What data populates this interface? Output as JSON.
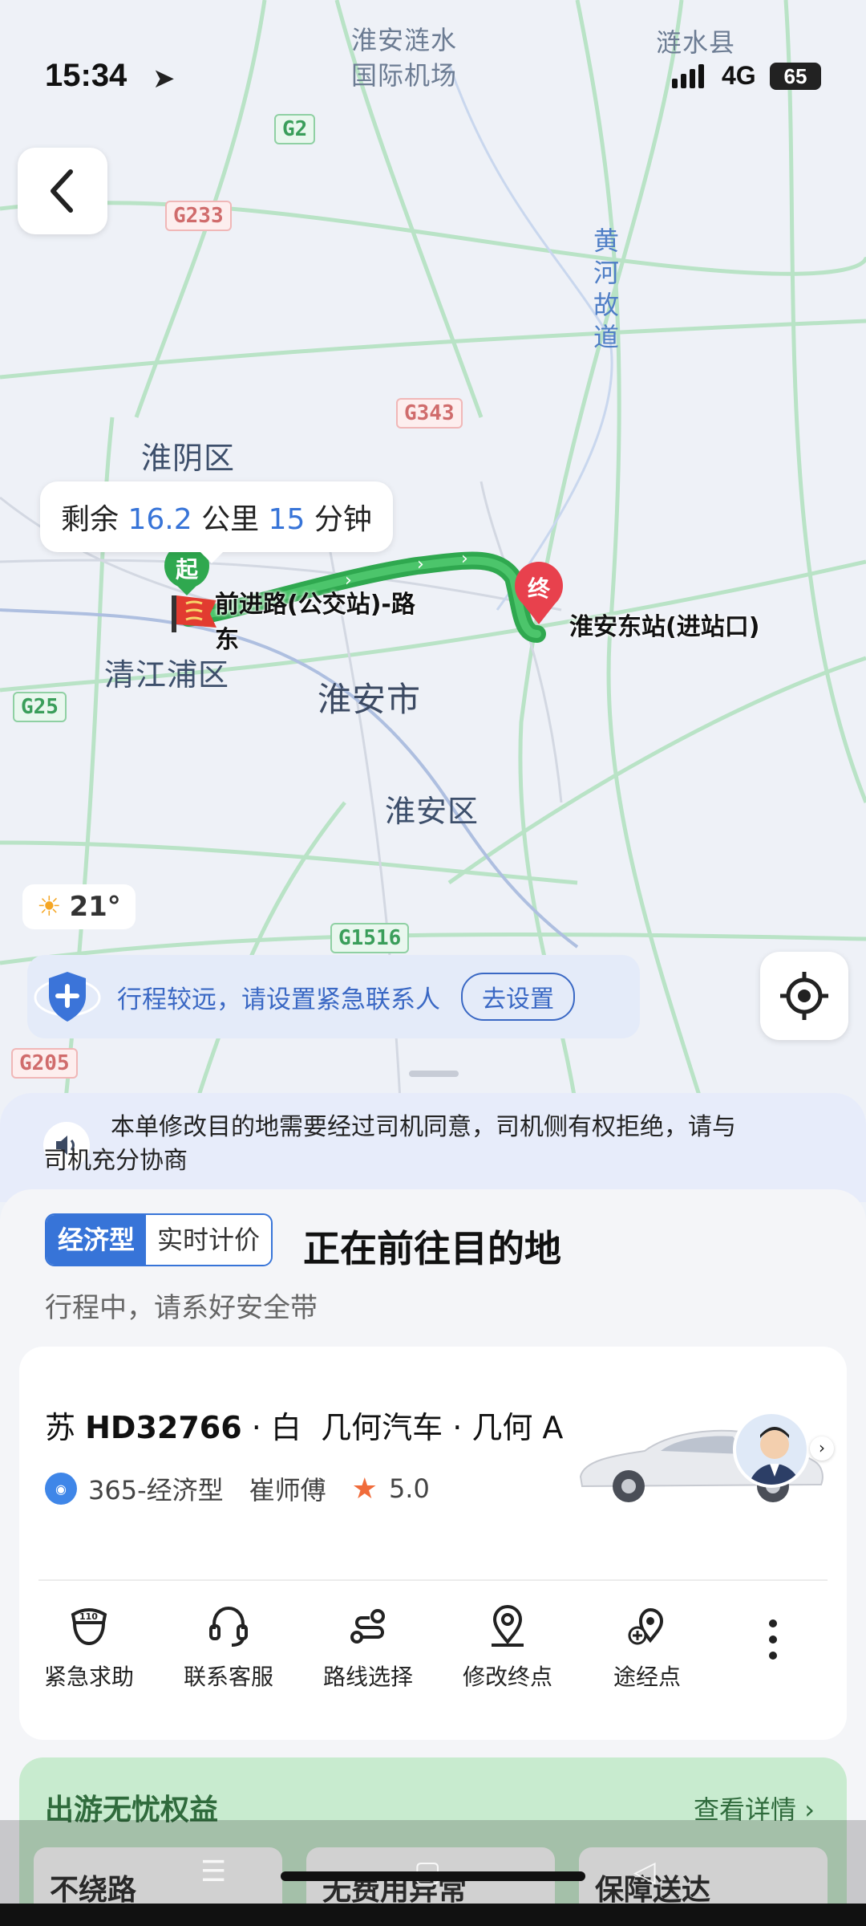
{
  "status_bar": {
    "time": "15:34",
    "network": "4G",
    "battery": "65"
  },
  "map": {
    "places": {
      "airport": "淮安涟水\n国际机场",
      "lianshui": "涟水县",
      "huangheguodao": "黄河故道",
      "huaiyin": "淮阴区",
      "qingjiangpu": "清江浦区",
      "huaian_city": "淮安市",
      "huaian_district": "淮安区",
      "river": "河"
    },
    "roads": [
      "G2",
      "G233",
      "G343",
      "G25",
      "G1516",
      "G205"
    ],
    "route_summary": {
      "prefix": "剩余",
      "distance": "16.2",
      "distance_unit": "公里",
      "minutes": "15",
      "minutes_unit": "分钟"
    },
    "start_marker": "起",
    "start_label_line1": "前进路(公交站)-路",
    "start_label_line2": "东",
    "end_marker": "终",
    "end_label": "淮安东站(进站口)",
    "weather": {
      "temp": "21°",
      "icon": "sun-icon"
    },
    "emergency": {
      "text": "行程较远，请设置紧急联系人",
      "button": "去设置"
    }
  },
  "notice": {
    "line1": "本单修改目的地需要经过司机同意，司机侧有权拒绝，请与",
    "line2": "司机充分协商"
  },
  "trip": {
    "tag_type": "经济型",
    "tag_price": "实时计价",
    "title": "正在前往目的地",
    "subtitle": "行程中，请系好安全带"
  },
  "car": {
    "plate_prefix": "苏",
    "plate": "HD32766",
    "color": "· 白",
    "model": "几何汽车 · 几何 A",
    "service": "365-经济型",
    "driver": "崔师傅",
    "rating": "5.0"
  },
  "actions": [
    {
      "label": "紧急求助",
      "icon": "police-110-icon"
    },
    {
      "label": "联系客服",
      "icon": "headset-icon"
    },
    {
      "label": "路线选择",
      "icon": "route-icon"
    },
    {
      "label": "修改终点",
      "icon": "location-pin-icon"
    },
    {
      "label": "途经点",
      "icon": "add-waypoint-icon"
    }
  ],
  "benefit": {
    "title": "出游无忧权益",
    "details": "查看详情",
    "chips": [
      "不绕路",
      "无费用异常",
      "保障送达"
    ]
  },
  "colors": {
    "accent": "#3774d8",
    "route": "#2fa84f",
    "end_marker": "#e8414d"
  }
}
